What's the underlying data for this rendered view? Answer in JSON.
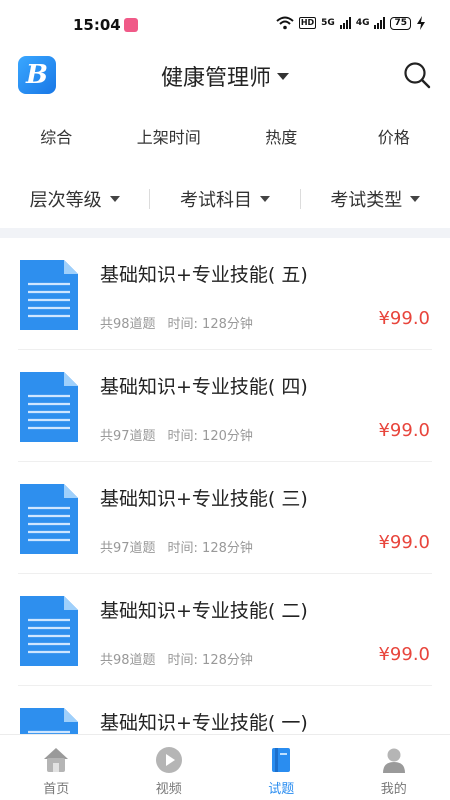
{
  "status_bar": {
    "time": "15:04",
    "hd": "HD",
    "net1": "5G",
    "net2": "4G",
    "battery": "75"
  },
  "header": {
    "logo_letter": "B",
    "title": "健康管理师"
  },
  "sort_tabs": [
    {
      "label": "综合"
    },
    {
      "label": "上架时间"
    },
    {
      "label": "热度"
    },
    {
      "label": "价格"
    }
  ],
  "filters": [
    {
      "label": "层次等级"
    },
    {
      "label": "考试科目"
    },
    {
      "label": "考试类型"
    }
  ],
  "items": [
    {
      "title": "基础知识+专业技能( 五)",
      "count": "共98道题",
      "time": "时间: 128分钟",
      "price": "¥99.0"
    },
    {
      "title": "基础知识+专业技能( 四)",
      "count": "共97道题",
      "time": "时间: 120分钟",
      "price": "¥99.0"
    },
    {
      "title": "基础知识+专业技能( 三)",
      "count": "共97道题",
      "time": "时间: 128分钟",
      "price": "¥99.0"
    },
    {
      "title": "基础知识+专业技能( 二)",
      "count": "共98道题",
      "time": "时间: 128分钟",
      "price": "¥99.0"
    },
    {
      "title": "基础知识+专业技能( 一)",
      "count": "",
      "time": "",
      "price": ""
    }
  ],
  "bottom_nav": [
    {
      "label": "首页",
      "icon": "home-icon"
    },
    {
      "label": "视频",
      "icon": "video-icon"
    },
    {
      "label": "试题",
      "icon": "book-icon"
    },
    {
      "label": "我的",
      "icon": "profile-icon"
    }
  ],
  "colors": {
    "accent": "#2a8df0",
    "price": "#e8453c",
    "doc_blue": "#2e8fee"
  }
}
